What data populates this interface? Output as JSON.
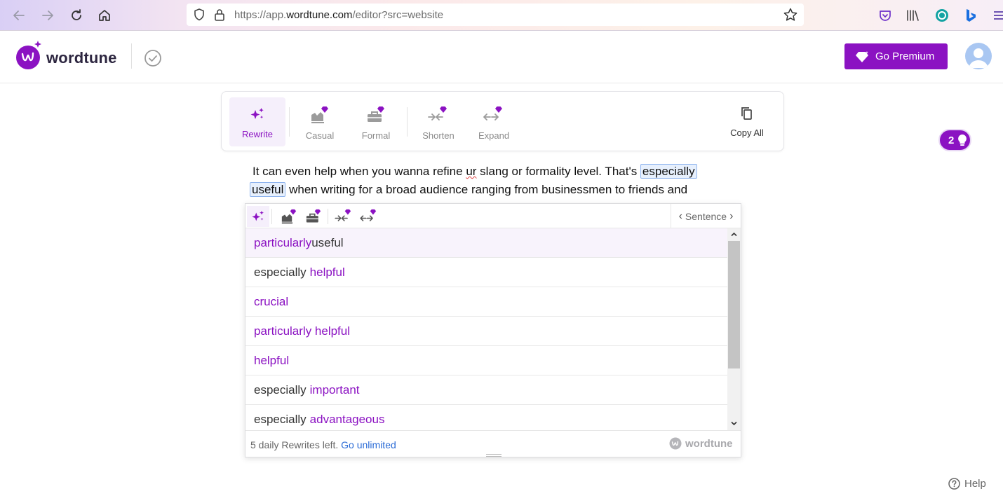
{
  "browser": {
    "url_prefix": "https://app.",
    "url_domain": "wordtune.com",
    "url_suffix": "/editor?src=website"
  },
  "header": {
    "logo_text": "wordtune",
    "premium_label": "Go Premium"
  },
  "toolbar": {
    "tools": [
      {
        "label": "Rewrite"
      },
      {
        "label": "Casual"
      },
      {
        "label": "Formal"
      },
      {
        "label": "Shorten"
      },
      {
        "label": "Expand"
      }
    ],
    "copy_all": "Copy All"
  },
  "badge": {
    "count": "2"
  },
  "editor": {
    "line1_a": "It can even help when you wanna refine ",
    "line1_misspelled": "ur",
    "line1_b": " slang or formality level. That's ",
    "highlight1": "especially",
    "highlight2": "useful",
    "line2_b": " when writing for a broad audience ranging from businessmen to friends and"
  },
  "popup": {
    "mode": "Sentence",
    "suggestions": [
      {
        "changed": "particularly",
        "rest": " useful",
        "order": "changed-first"
      },
      {
        "pre": "especially ",
        "changed": "helpful",
        "order": "changed-last"
      },
      {
        "changed": "crucial",
        "rest": "",
        "order": "changed-first"
      },
      {
        "changed": "particularly helpful",
        "rest": "",
        "order": "changed-first"
      },
      {
        "changed": "helpful",
        "rest": "",
        "order": "changed-first"
      },
      {
        "pre": "especially ",
        "changed": "important",
        "order": "changed-last"
      },
      {
        "pre": "especially ",
        "changed": "advantageous",
        "order": "changed-last"
      }
    ],
    "footer_text": "5 daily Rewrites left.",
    "footer_link": "Go unlimited",
    "footer_logo": "wordtune"
  },
  "help": {
    "label": "Help"
  },
  "colors": {
    "brand": "#8b12c2",
    "link": "#2a6bd6"
  }
}
